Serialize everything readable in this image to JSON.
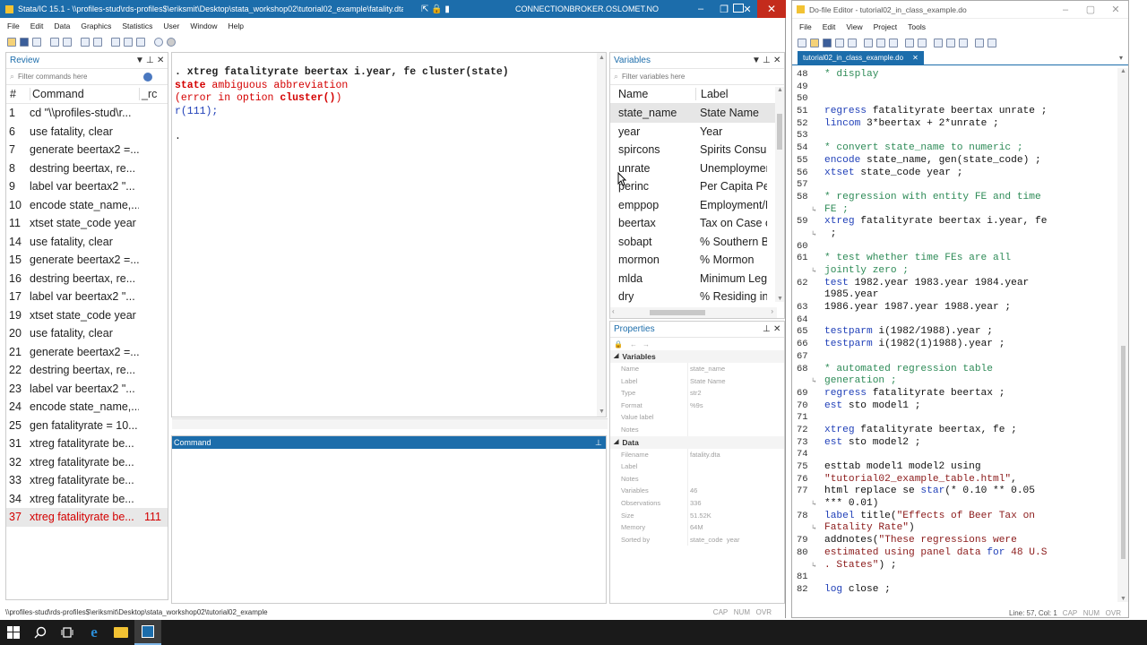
{
  "stata": {
    "title": "Stata/IC 15.1 - \\\\profiles-stud\\rds-profiles$\\eriksmit\\Desktop\\stata_workshop02\\tutorial02_example\\fatality.dta",
    "connection": "CONNECTIONBROKER.OSLOMET.NO",
    "menu": [
      "File",
      "Edit",
      "Data",
      "Graphics",
      "Statistics",
      "User",
      "Window",
      "Help"
    ],
    "review": {
      "title": "Review",
      "filter_placeholder": "Filter commands here",
      "col_num": "#",
      "col_cmd": "Command",
      "col_rc": "_rc",
      "rows": [
        {
          "n": "1",
          "cmd": "cd \"\\\\profiles-stud\\r...",
          "rc": ""
        },
        {
          "n": "6",
          "cmd": "use fatality, clear",
          "rc": ""
        },
        {
          "n": "7",
          "cmd": "generate beertax2 =...",
          "rc": ""
        },
        {
          "n": "8",
          "cmd": "destring beertax, re...",
          "rc": ""
        },
        {
          "n": "9",
          "cmd": "label var beertax2 \"...",
          "rc": ""
        },
        {
          "n": "10",
          "cmd": "encode state_name,...",
          "rc": ""
        },
        {
          "n": "11",
          "cmd": "xtset state_code year",
          "rc": ""
        },
        {
          "n": "14",
          "cmd": "use fatality, clear",
          "rc": ""
        },
        {
          "n": "15",
          "cmd": "generate beertax2 =...",
          "rc": ""
        },
        {
          "n": "16",
          "cmd": "destring beertax, re...",
          "rc": ""
        },
        {
          "n": "17",
          "cmd": "label var beertax2 \"...",
          "rc": ""
        },
        {
          "n": "19",
          "cmd": "xtset state_code year",
          "rc": ""
        },
        {
          "n": "20",
          "cmd": "use fatality, clear",
          "rc": ""
        },
        {
          "n": "21",
          "cmd": "generate beertax2 =...",
          "rc": ""
        },
        {
          "n": "22",
          "cmd": "destring beertax, re...",
          "rc": ""
        },
        {
          "n": "23",
          "cmd": "label var beertax2 \"...",
          "rc": ""
        },
        {
          "n": "24",
          "cmd": "encode state_name,...",
          "rc": ""
        },
        {
          "n": "25",
          "cmd": "gen fatalityrate = 10...",
          "rc": ""
        },
        {
          "n": "31",
          "cmd": "xtreg fatalityrate be...",
          "rc": ""
        },
        {
          "n": "32",
          "cmd": "xtreg fatalityrate be...",
          "rc": ""
        },
        {
          "n": "33",
          "cmd": "xtreg fatalityrate be...",
          "rc": ""
        },
        {
          "n": "34",
          "cmd": "xtreg fatalityrate be...",
          "rc": ""
        },
        {
          "n": "37",
          "cmd": "xtreg fatalityrate be...",
          "rc": "111",
          "error": true
        }
      ]
    },
    "results": {
      "line1": ". xtreg fatalityrate beertax i.year, fe cluster(state)",
      "line2a": "state",
      "line2b": " ambiguous abbreviation",
      "line3a": "(error in option ",
      "line3b": "cluster()",
      "line3c": ")",
      "line4": "r(111);",
      "line5": "."
    },
    "command_title": "Command",
    "variables": {
      "title": "Variables",
      "filter_placeholder": "Filter variables here",
      "col_name": "Name",
      "col_label": "Label",
      "rows": [
        {
          "name": "state_name",
          "label": "State Name"
        },
        {
          "name": "year",
          "label": "Year"
        },
        {
          "name": "spircons",
          "label": "Spirits Consun"
        },
        {
          "name": "unrate",
          "label": "Unemploymer"
        },
        {
          "name": "perinc",
          "label": "Per Capita Per"
        },
        {
          "name": "emppop",
          "label": "Employment/F"
        },
        {
          "name": "beertax",
          "label": "Tax on Case of"
        },
        {
          "name": "sobapt",
          "label": "% Southern Ba"
        },
        {
          "name": "mormon",
          "label": "% Mormon"
        },
        {
          "name": "mlda",
          "label": "Minimum Lega"
        },
        {
          "name": "dry",
          "label": "% Residing in"
        }
      ]
    },
    "properties": {
      "title": "Properties",
      "sec_vars": "Variables",
      "vars": [
        {
          "k": "Name",
          "v": "state_name"
        },
        {
          "k": "Label",
          "v": "State Name"
        },
        {
          "k": "Type",
          "v": "str2"
        },
        {
          "k": "Format",
          "v": "%9s"
        },
        {
          "k": "Value label",
          "v": ""
        },
        {
          "k": "Notes",
          "v": ""
        }
      ],
      "sec_data": "Data",
      "data": [
        {
          "k": "Filename",
          "v": "fatality.dta"
        },
        {
          "k": "Label",
          "v": ""
        },
        {
          "k": "Notes",
          "v": ""
        },
        {
          "k": "Variables",
          "v": "46"
        },
        {
          "k": "Observations",
          "v": "336"
        },
        {
          "k": "Size",
          "v": "51.52K"
        },
        {
          "k": "Memory",
          "v": "64M"
        },
        {
          "k": "Sorted by",
          "v": "state_code  year"
        }
      ]
    },
    "status_path": "\\\\profiles-stud\\rds-profiles$\\eriksmit\\Desktop\\stata_workshop02\\tutorial02_example",
    "status_right": "CAP   NUM   OVR"
  },
  "editor": {
    "title": "Do-file Editor - tutorial02_in_class_example.do",
    "menu": [
      "File",
      "Edit",
      "View",
      "Project",
      "Tools"
    ],
    "tab": "tutorial02_in_class_example.do",
    "lines": [
      {
        "n": "48",
        "segs": [
          {
            "t": "* display",
            "c": "cm"
          }
        ]
      },
      {
        "n": "49",
        "segs": []
      },
      {
        "n": "50",
        "segs": []
      },
      {
        "n": "51",
        "segs": [
          {
            "t": "regress",
            "c": "kw"
          },
          {
            "t": " fatalityrate beertax unrate ;",
            "c": "tx"
          }
        ]
      },
      {
        "n": "52",
        "segs": [
          {
            "t": "lincom",
            "c": "kw"
          },
          {
            "t": " 3*beertax + 2*unrate ;",
            "c": "tx"
          }
        ]
      },
      {
        "n": "53",
        "segs": []
      },
      {
        "n": "54",
        "segs": [
          {
            "t": "* convert state_name to numeric ;",
            "c": "cm"
          }
        ]
      },
      {
        "n": "55",
        "segs": [
          {
            "t": "encode",
            "c": "kw"
          },
          {
            "t": " state_name, gen(state_code) ;",
            "c": "tx"
          }
        ]
      },
      {
        "n": "56",
        "segs": [
          {
            "t": "xtset",
            "c": "kw"
          },
          {
            "t": " state_code year ;",
            "c": "tx"
          }
        ]
      },
      {
        "n": "57",
        "segs": []
      },
      {
        "n": "58",
        "segs": [
          {
            "t": "* regression with entity FE and time",
            "c": "cm"
          }
        ]
      },
      {
        "n": "",
        "wrap": true,
        "segs": [
          {
            "t": "FE ;",
            "c": "cm"
          }
        ]
      },
      {
        "n": "59",
        "segs": [
          {
            "t": "xtreg",
            "c": "kw"
          },
          {
            "t": " fatalityrate beertax i.year, fe",
            "c": "tx"
          }
        ]
      },
      {
        "n": "",
        "wrap": true,
        "segs": [
          {
            "t": " ;",
            "c": "tx"
          }
        ]
      },
      {
        "n": "60",
        "segs": []
      },
      {
        "n": "61",
        "segs": [
          {
            "t": "* test whether time FEs are all",
            "c": "cm"
          }
        ]
      },
      {
        "n": "",
        "wrap": true,
        "segs": [
          {
            "t": "jointly zero ;",
            "c": "cm"
          }
        ]
      },
      {
        "n": "62",
        "segs": [
          {
            "t": "test",
            "c": "kw"
          },
          {
            "t": " 1982.year 1983.year 1984.year",
            "c": "tx"
          }
        ]
      },
      {
        "n": "",
        "segs": [
          {
            "t": "1985.year",
            "c": "tx"
          }
        ]
      },
      {
        "n": "63",
        "segs": [
          {
            "t": "1986.year 1987.year 1988.year ;",
            "c": "tx"
          }
        ]
      },
      {
        "n": "64",
        "segs": []
      },
      {
        "n": "65",
        "segs": [
          {
            "t": "testparm",
            "c": "kw"
          },
          {
            "t": " i(1982/1988).year ;",
            "c": "tx"
          }
        ]
      },
      {
        "n": "66",
        "segs": [
          {
            "t": "testparm",
            "c": "kw"
          },
          {
            "t": " i(1982(1)1988).year ;",
            "c": "tx"
          }
        ]
      },
      {
        "n": "67",
        "segs": []
      },
      {
        "n": "68",
        "segs": [
          {
            "t": "* automated regression table",
            "c": "cm"
          }
        ]
      },
      {
        "n": "",
        "wrap": true,
        "segs": [
          {
            "t": "generation ;",
            "c": "cm"
          }
        ]
      },
      {
        "n": "69",
        "segs": [
          {
            "t": "regress",
            "c": "kw"
          },
          {
            "t": " fatalityrate beertax ;",
            "c": "tx"
          }
        ]
      },
      {
        "n": "70",
        "segs": [
          {
            "t": "est",
            "c": "kw"
          },
          {
            "t": " sto model1 ;",
            "c": "tx"
          }
        ]
      },
      {
        "n": "71",
        "segs": []
      },
      {
        "n": "72",
        "segs": [
          {
            "t": "xtreg",
            "c": "kw"
          },
          {
            "t": " fatalityrate beertax, fe ;",
            "c": "tx"
          }
        ]
      },
      {
        "n": "73",
        "segs": [
          {
            "t": "est",
            "c": "kw"
          },
          {
            "t": " sto model2 ;",
            "c": "tx"
          }
        ]
      },
      {
        "n": "74",
        "segs": []
      },
      {
        "n": "75",
        "segs": [
          {
            "t": "esttab model1 model2 using",
            "c": "tx"
          }
        ]
      },
      {
        "n": "76",
        "segs": [
          {
            "t": "\"tutorial02_example_table.html\"",
            "c": "st"
          },
          {
            "t": ",",
            "c": "tx"
          }
        ]
      },
      {
        "n": "77",
        "segs": [
          {
            "t": "html replace se ",
            "c": "tx"
          },
          {
            "t": "star",
            "c": "kw"
          },
          {
            "t": "(* 0.10 ** 0.05",
            "c": "tx"
          }
        ]
      },
      {
        "n": "",
        "wrap": true,
        "segs": [
          {
            "t": "*** 0.01)",
            "c": "tx"
          }
        ]
      },
      {
        "n": "78",
        "segs": [
          {
            "t": "label",
            "c": "kw"
          },
          {
            "t": " title(",
            "c": "tx"
          },
          {
            "t": "\"Effects of Beer Tax on",
            "c": "st"
          }
        ]
      },
      {
        "n": "",
        "wrap": true,
        "segs": [
          {
            "t": "Fatality Rate\"",
            "c": "st"
          },
          {
            "t": ")",
            "c": "tx"
          }
        ]
      },
      {
        "n": "79",
        "segs": [
          {
            "t": "addnotes(",
            "c": "tx"
          },
          {
            "t": "\"These regressions were",
            "c": "st"
          }
        ]
      },
      {
        "n": "80",
        "segs": [
          {
            "t": "estimated using panel data ",
            "c": "st"
          },
          {
            "t": "for",
            "c": "kw"
          },
          {
            "t": " 48 U.S",
            "c": "st"
          }
        ]
      },
      {
        "n": "",
        "wrap": true,
        "segs": [
          {
            "t": ". States\"",
            "c": "st"
          },
          {
            "t": ") ;",
            "c": "tx"
          }
        ]
      },
      {
        "n": "81",
        "segs": []
      },
      {
        "n": "82",
        "segs": [
          {
            "t": "log",
            "c": "kw"
          },
          {
            "t": " close ;",
            "c": "tx"
          }
        ]
      }
    ],
    "status_pos": "Line: 57, Col: 1",
    "status_right": "CAP   NUM   OVR"
  },
  "colors": {
    "accent": "#1c6dab",
    "error": "#d40000",
    "comment": "#2e8b57",
    "keyword": "#1f3fb8",
    "string": "#8b1a1a"
  }
}
